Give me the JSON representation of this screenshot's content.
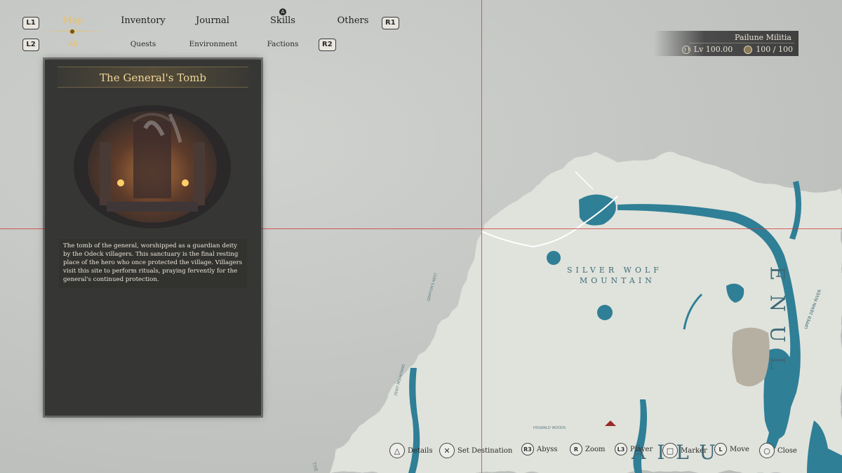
{
  "nav": {
    "left_bumper": "L1",
    "right_bumper": "R1",
    "left_trigger": "L2",
    "right_trigger": "R2",
    "tabs": [
      {
        "label": "Map",
        "active": true
      },
      {
        "label": "Inventory",
        "active": false
      },
      {
        "label": "Journal",
        "active": false
      },
      {
        "label": "Skills",
        "active": false
      },
      {
        "label": "Others",
        "active": false
      }
    ],
    "skills_badge": "A",
    "subtabs": [
      {
        "label": "All",
        "active": true
      },
      {
        "label": "Quests",
        "active": false
      },
      {
        "label": "Environment",
        "active": false
      },
      {
        "label": "Factions",
        "active": false
      }
    ]
  },
  "player": {
    "faction": "Pailune Militia",
    "level": "Lv 100.00",
    "hp": "100 / 100"
  },
  "location": {
    "title": "The General's Tomb",
    "description": "The tomb of the general, worshipped as a guardian deity by the Odeck villagers. This sanctuary is the final resting place of the hero who once protected the village. Villagers visit this site to perform rituals, praying fervently for the general's continued protection."
  },
  "map": {
    "labels": {
      "mountain_line1": "SILVER WOLF",
      "mountain_line2": "MOUNTAIN",
      "region_east": "ENUL",
      "region_south": "AILU",
      "river_upper": "UPPER DEMN RIVER",
      "small_label_1": "GRIFFON'S NEST",
      "small_label_2": "HOLWALD WOODS",
      "small_label_3": "ZENIT MOUNTAINS",
      "edge_label": "THE"
    },
    "colors": {
      "water": "#2f7f96",
      "land": "#e0e3dc",
      "fog": "#c5c8c5",
      "crosshair": "#d23a3a"
    }
  },
  "controls": [
    {
      "icon": "triangle-icon",
      "glyph": "△",
      "label": "Details"
    },
    {
      "icon": "cross-icon",
      "glyph": "✕",
      "label": "Set Destination"
    },
    {
      "icon": "r3-icon",
      "glyph": "R3",
      "label": "Abyss"
    },
    {
      "icon": "r-stick-icon",
      "glyph": "R",
      "label": "Zoom"
    },
    {
      "icon": "l3-icon",
      "glyph": "L3",
      "label": "Player"
    },
    {
      "icon": "square-icon",
      "glyph": "□",
      "label": "Marker"
    },
    {
      "icon": "l-stick-icon",
      "glyph": "L",
      "label": "Move"
    },
    {
      "icon": "circle-icon",
      "glyph": "○",
      "label": "Close"
    }
  ]
}
